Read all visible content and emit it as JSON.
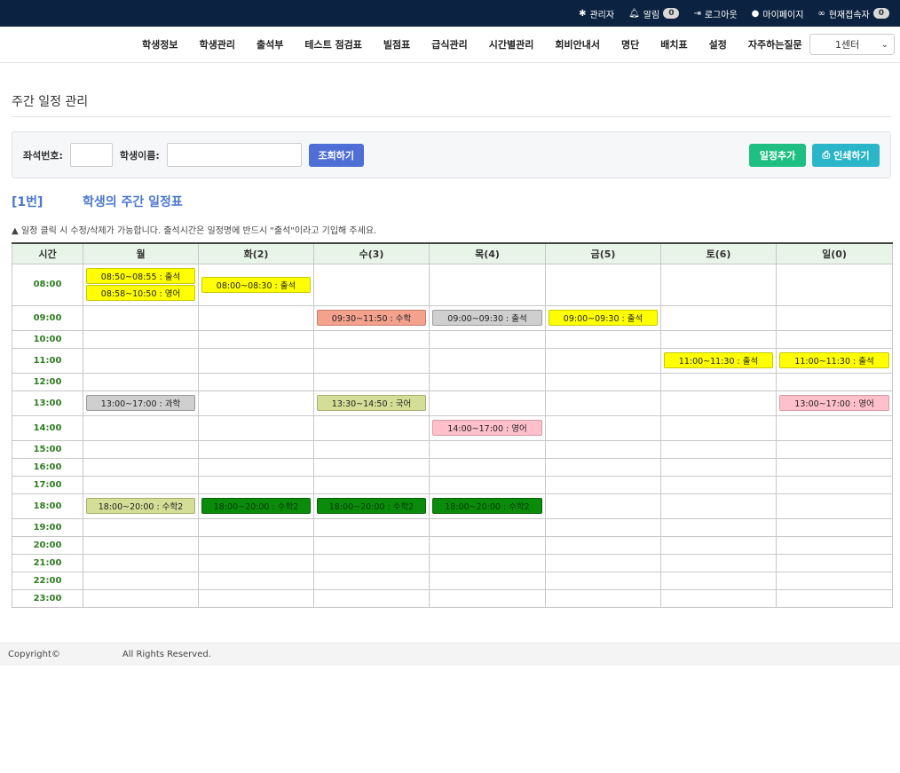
{
  "topbar": {
    "admin": "관리자",
    "alarm": "알림",
    "alarm_count": "0",
    "logout": "로그아웃",
    "mypage": "마이페이지",
    "online": "현재접속자",
    "online_count": "0"
  },
  "nav": {
    "items": [
      "학생정보",
      "학생관리",
      "출석부",
      "테스트 점검표",
      "빌점표",
      "급식관리",
      "시간별관리",
      "회비안내서",
      "명단",
      "배치표",
      "설정",
      "자주하는질문"
    ],
    "center_select": "1센터"
  },
  "page_title": "주간 일정 관리",
  "search": {
    "seat_label": "좌석번호:",
    "seat_value": "",
    "name_label": "학생이름:",
    "name_value": "",
    "query_button": "조회하기",
    "add_button": "일정추가",
    "print_button": "인쇄하기"
  },
  "schedule": {
    "seat": "[1번]",
    "title": "학생의 주간 일정표",
    "notice": "일정 클릭 시 수정/삭제가 가능합니다. 출석시간은 일정명에 반드시 \"출석\"이라고 기입해 주세요.",
    "time_header": "시간",
    "days": [
      "월",
      "화(2)",
      "수(3)",
      "목(4)",
      "금(5)",
      "토(6)",
      "일(0)"
    ],
    "rows": [
      {
        "time": "08:00",
        "cells": [
          [
            {
              "text": "08:50~08:55 : 출석",
              "color": "yellow"
            },
            {
              "text": "08:58~10:50 : 영어",
              "color": "yellow"
            }
          ],
          [
            {
              "text": "08:00~08:30 : 출석",
              "color": "yellow"
            }
          ],
          [],
          [],
          [],
          [],
          []
        ]
      },
      {
        "time": "09:00",
        "cells": [
          [],
          [],
          [
            {
              "text": "09:30~11:50 : 수학",
              "color": "salmon"
            }
          ],
          [
            {
              "text": "09:00~09:30 : 출석",
              "color": "gray"
            }
          ],
          [
            {
              "text": "09:00~09:30 : 출석",
              "color": "yellow"
            }
          ],
          [],
          []
        ]
      },
      {
        "time": "10:00",
        "cells": [
          [],
          [],
          [],
          [],
          [],
          [],
          []
        ]
      },
      {
        "time": "11:00",
        "cells": [
          [],
          [],
          [],
          [],
          [],
          [
            {
              "text": "11:00~11:30 : 출석",
              "color": "yellow"
            }
          ],
          [
            {
              "text": "11:00~11:30 : 출석",
              "color": "yellow"
            }
          ]
        ]
      },
      {
        "time": "12:00",
        "cells": [
          [],
          [],
          [],
          [],
          [],
          [],
          []
        ]
      },
      {
        "time": "13:00",
        "cells": [
          [
            {
              "text": "13:00~17:00 : 과학",
              "color": "gray"
            }
          ],
          [],
          [
            {
              "text": "13:30~14:50 : 국어",
              "color": "olive"
            }
          ],
          [],
          [],
          [],
          [
            {
              "text": "13:00~17:00 : 영어",
              "color": "pink"
            }
          ]
        ]
      },
      {
        "time": "14:00",
        "cells": [
          [],
          [],
          [],
          [
            {
              "text": "14:00~17:00 : 영어",
              "color": "pink"
            }
          ],
          [],
          [],
          []
        ]
      },
      {
        "time": "15:00",
        "cells": [
          [],
          [],
          [],
          [],
          [],
          [],
          []
        ]
      },
      {
        "time": "16:00",
        "cells": [
          [],
          [],
          [],
          [],
          [],
          [],
          []
        ]
      },
      {
        "time": "17:00",
        "cells": [
          [],
          [],
          [],
          [],
          [],
          [],
          []
        ]
      },
      {
        "time": "18:00",
        "cells": [
          [
            {
              "text": "18:00~20:00 : 수학2",
              "color": "olive"
            }
          ],
          [
            {
              "text": "18:00~20:00 : 수학2",
              "color": "green"
            }
          ],
          [
            {
              "text": "18:00~20:00 : 수학2",
              "color": "green"
            }
          ],
          [
            {
              "text": "18:00~20:00 : 수학2",
              "color": "green"
            }
          ],
          [],
          [],
          []
        ]
      },
      {
        "time": "19:00",
        "cells": [
          [],
          [],
          [],
          [],
          [],
          [],
          []
        ]
      },
      {
        "time": "20:00",
        "cells": [
          [],
          [],
          [],
          [],
          [],
          [],
          []
        ]
      },
      {
        "time": "21:00",
        "cells": [
          [],
          [],
          [],
          [],
          [],
          [],
          []
        ]
      },
      {
        "time": "22:00",
        "cells": [
          [],
          [],
          [],
          [],
          [],
          [],
          []
        ]
      },
      {
        "time": "23:00",
        "cells": [
          [],
          [],
          [],
          [],
          [],
          [],
          []
        ]
      }
    ]
  },
  "footer": {
    "copyright": "Copyright©",
    "rights": "All Rights Reserved."
  }
}
